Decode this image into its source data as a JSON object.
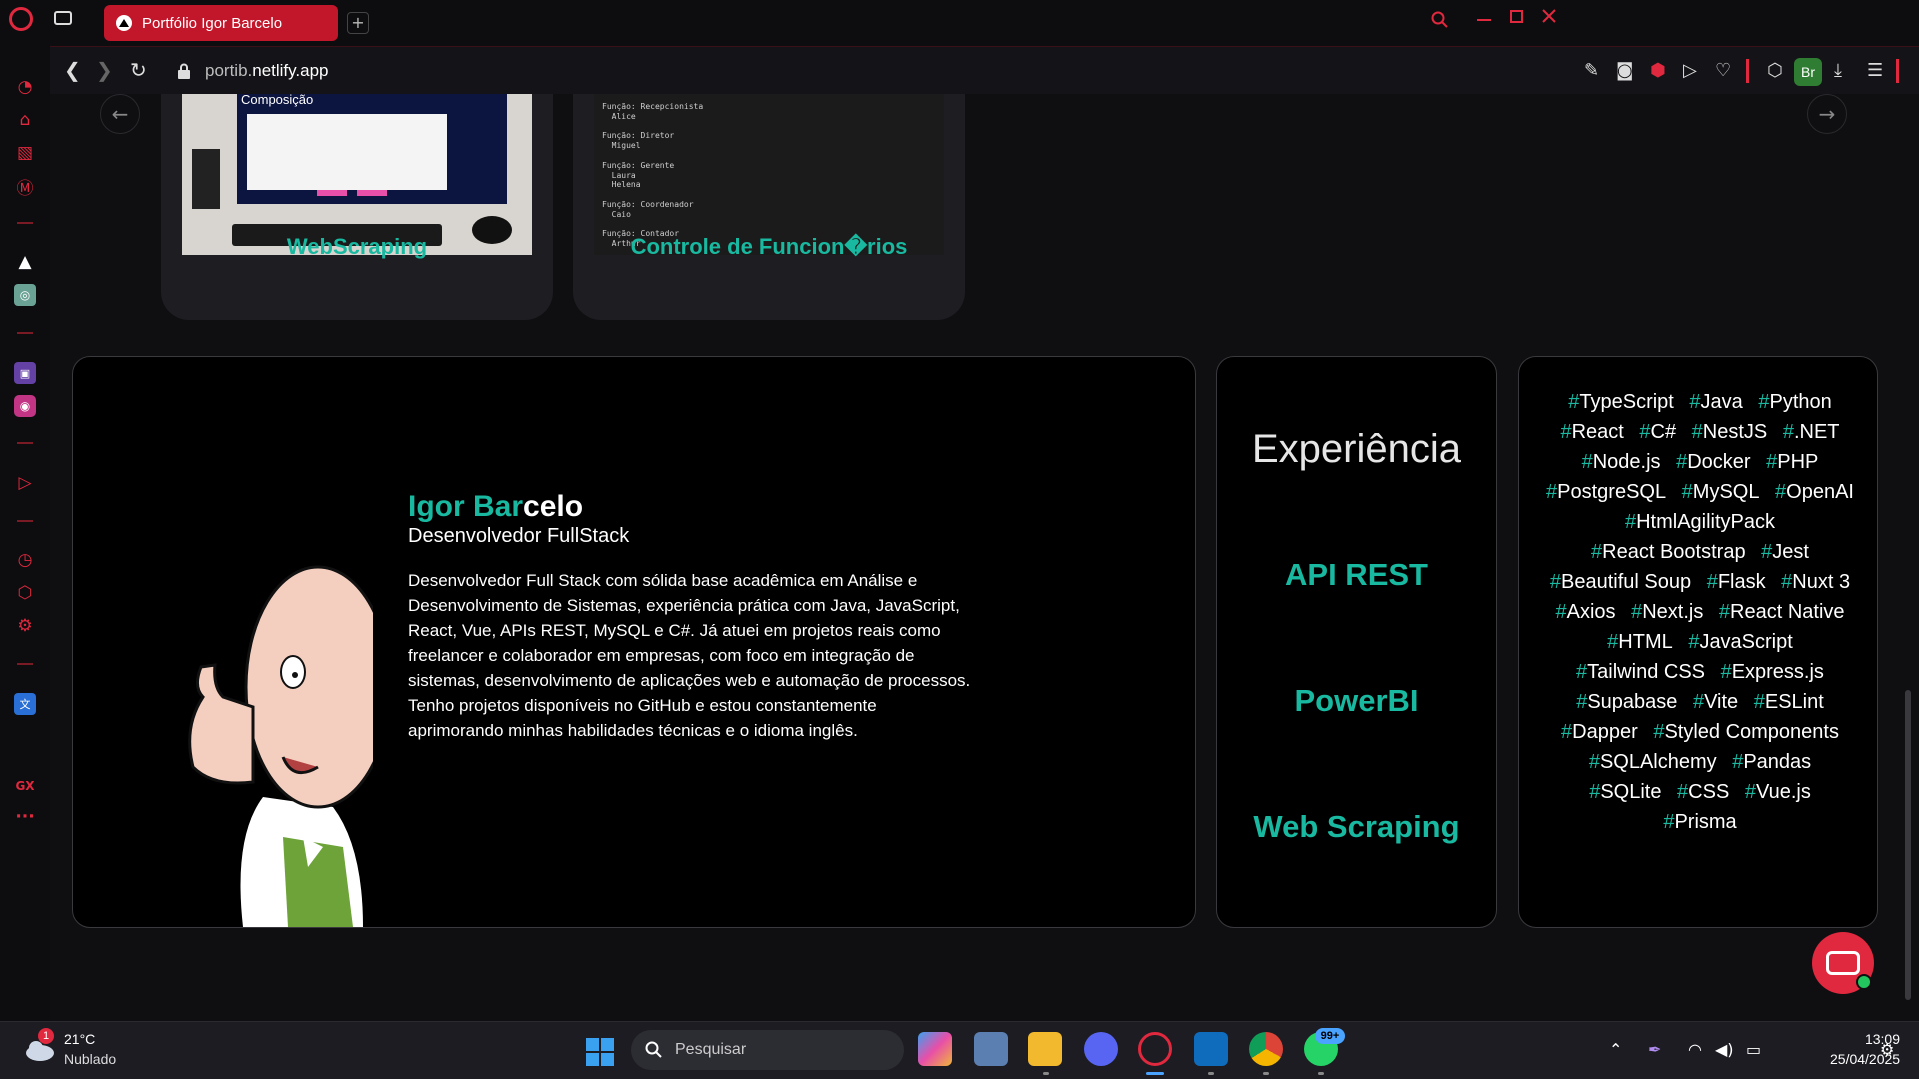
{
  "browser": {
    "tab_title": "Portfólio Igor Barcelo",
    "new_tab_symbol": "+",
    "url_prefix": "portib.",
    "url_domain": "netlify.app",
    "profile_initials": "Br",
    "sidebar_gx_label": "GX",
    "sidebar_more": "···"
  },
  "projects": {
    "cards": [
      {
        "title": "WebScraping",
        "image_caption": "Composição"
      },
      {
        "title": "Controle de Funcion�rios"
      }
    ],
    "terminal_lines": [
      "Função: Recepcionista",
      "  Alice",
      "",
      "Função: Diretor",
      "  Miguel",
      "",
      "Função: Gerente",
      "  Laura",
      "  Helena",
      "",
      "Função: Coordenador",
      "  Caio",
      "",
      "Função: Contador",
      "  Arthur"
    ]
  },
  "profile": {
    "name_first": "Igor Bar",
    "name_last": "celo",
    "role": "Desenvolvedor FullStack",
    "bio": "Desenvolvedor Full Stack com sólida base acadêmica em Análise e Desenvolvimento de Sistemas, experiência prática com Java, JavaScript, React, Vue, APIs REST, MySQL e C#. Já atuei em projetos reais como freelancer e colaborador em empresas, com foco em integração de sistemas, desenvolvimento de aplicações web e automação de processos. Tenho projetos disponíveis no GitHub e estou constantemente aprimorando minhas habilidades técnicas e o idioma inglês."
  },
  "experience": {
    "title": "Experiência",
    "items": [
      "API REST",
      "PowerBI",
      "Web Scraping"
    ]
  },
  "tags": [
    "TypeScript",
    "Java",
    "Python",
    "React",
    "C#",
    "NestJS",
    ".NET",
    "Node.js",
    "Docker",
    "PHP",
    "PostgreSQL",
    "MySQL",
    "OpenAI",
    "HtmlAgilityPack",
    "React Bootstrap",
    "Jest",
    "Beautiful Soup",
    "Flask",
    "Nuxt 3",
    "Axios",
    "Next.js",
    "React Native",
    "HTML",
    "JavaScript",
    "Tailwind CSS",
    "Express.js",
    "Supabase",
    "Vite",
    "ESLint",
    "Dapper",
    "Styled Components",
    "SQLAlchemy",
    "Pandas",
    "SQLite",
    "CSS",
    "Vue.js",
    "Prisma"
  ],
  "taskbar": {
    "weather_badge": "1",
    "temperature": "21°C",
    "condition": "Nublado",
    "search_placeholder": "Pesquisar",
    "whatsapp_badge": "99+",
    "time": "13:09",
    "date": "25/04/2025"
  },
  "colors": {
    "accent": "#19b8a0",
    "opera_red": "#e0283e",
    "tab_red": "#c2162b"
  }
}
